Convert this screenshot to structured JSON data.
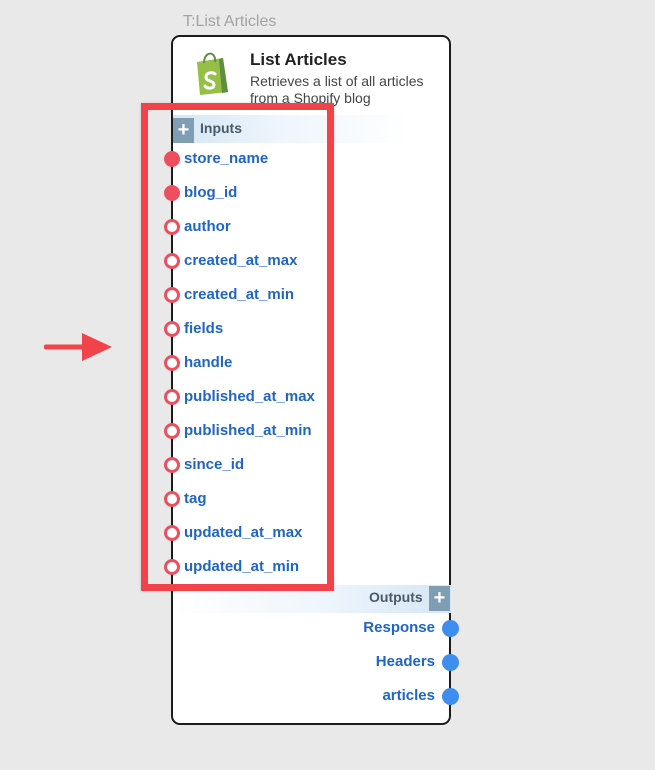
{
  "node": {
    "caption": "T:List Articles",
    "title": "List Articles",
    "description": "Retrieves a list of all articles from a Shopify blog",
    "icon": "shopify-bag-icon"
  },
  "inputs": {
    "label": "Inputs",
    "add_symbol": "+",
    "items": [
      {
        "name": "store_name",
        "required": true
      },
      {
        "name": "blog_id",
        "required": true
      },
      {
        "name": "author",
        "required": false
      },
      {
        "name": "created_at_max",
        "required": false
      },
      {
        "name": "created_at_min",
        "required": false
      },
      {
        "name": "fields",
        "required": false
      },
      {
        "name": "handle",
        "required": false
      },
      {
        "name": "published_at_max",
        "required": false
      },
      {
        "name": "published_at_min",
        "required": false
      },
      {
        "name": "since_id",
        "required": false
      },
      {
        "name": "tag",
        "required": false
      },
      {
        "name": "updated_at_max",
        "required": false
      },
      {
        "name": "updated_at_min",
        "required": false
      }
    ]
  },
  "outputs": {
    "label": "Outputs",
    "add_symbol": "+",
    "items": [
      "Response",
      "Headers",
      "articles"
    ]
  },
  "colors": {
    "port_required": "#ee4f5f",
    "port_output": "#3e8ef0",
    "label_blue": "#1f66c1",
    "highlight": "#f2434b",
    "shopify_green": "#95bf47"
  }
}
